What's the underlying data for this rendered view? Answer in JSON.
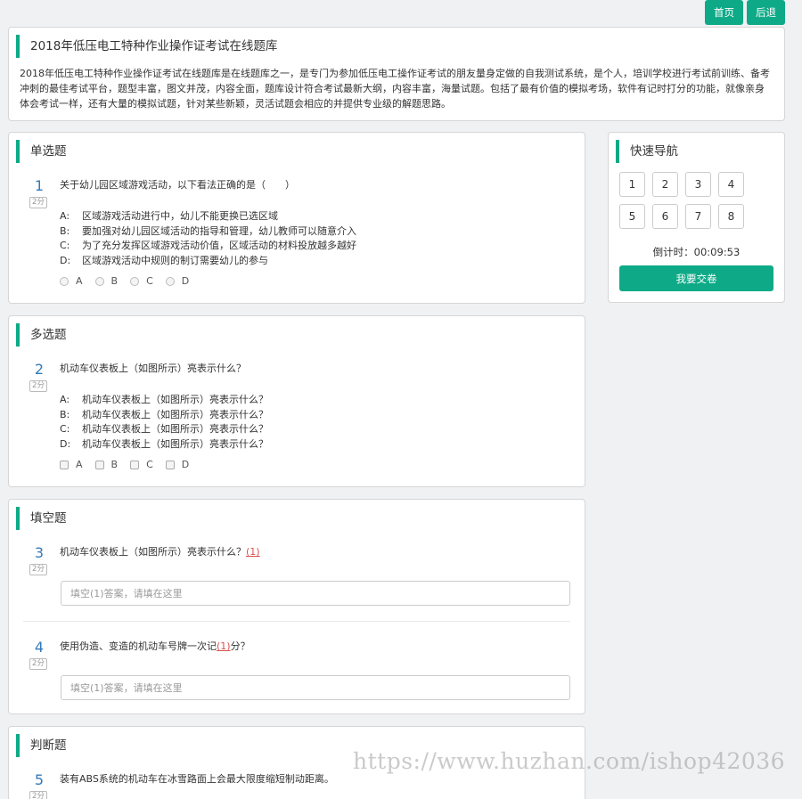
{
  "topbar": {
    "home_label": "首页",
    "back_label": "后退"
  },
  "intro": {
    "title": "2018年低压电工特种作业操作证考试在线题库",
    "description": "2018年低压电工特种作业操作证考试在线题库是在线题库之一，是专门为参加低压电工操作证考试的朋友量身定做的自我测试系统，是个人，培训学校进行考试前训练、备考冲刺的最佳考试平台，题型丰富，图文并茂，内容全面，题库设计符合考试最新大纲，内容丰富，海量试题。包括了最有价值的模拟考场，软件有记时打分的功能，就像亲身体会考试一样，还有大量的模拟试题，针对某些新颖，灵活试题会相应的并提供专业级的解题思路。"
  },
  "single": {
    "title": "单选题",
    "q": {
      "num": "1",
      "score": "2分",
      "text": "关于幼儿园区域游戏活动，以下看法正确的是（　　）",
      "options": [
        {
          "key": "A:",
          "text": "区域游戏活动进行中，幼儿不能更换已选区域"
        },
        {
          "key": "B:",
          "text": "要加强对幼儿园区域活动的指导和管理，幼儿教师可以随意介入"
        },
        {
          "key": "C:",
          "text": "为了充分发挥区域游戏活动价值，区域活动的材料投放越多越好"
        },
        {
          "key": "D:",
          "text": "区域游戏活动中规则的制订需要幼儿的参与"
        }
      ],
      "choices": [
        "A",
        "B",
        "C",
        "D"
      ]
    }
  },
  "multi": {
    "title": "多选题",
    "q": {
      "num": "2",
      "score": "2分",
      "text": "机动车仪表板上（如图所示）亮表示什么？",
      "options": [
        {
          "key": "A:",
          "text": "机动车仪表板上（如图所示）亮表示什么？"
        },
        {
          "key": "B:",
          "text": "机动车仪表板上（如图所示）亮表示什么？"
        },
        {
          "key": "C:",
          "text": "机动车仪表板上（如图所示）亮表示什么？"
        },
        {
          "key": "D:",
          "text": "机动车仪表板上（如图所示）亮表示什么？"
        }
      ],
      "choices": [
        "A",
        "B",
        "C",
        "D"
      ]
    }
  },
  "fill": {
    "title": "填空题",
    "q3": {
      "num": "3",
      "score": "2分",
      "text_before": "机动车仪表板上（如图所示）亮表示什么？",
      "blank": "(1)",
      "text_after": "",
      "placeholder": "填空(1)答案，请填在这里"
    },
    "q4": {
      "num": "4",
      "score": "2分",
      "text_before": "使用伪造、变造的机动车号牌一次记",
      "blank": "(1)",
      "text_after": "分？",
      "placeholder": "填空(1)答案，请填在这里"
    }
  },
  "judge": {
    "title": "判断题",
    "q": {
      "num": "5",
      "score": "2分",
      "text": "装有ABS系统的机动车在冰雪路面上会最大限度缩短制动距离。"
    }
  },
  "nav": {
    "title": "快速导航",
    "buttons": [
      "1",
      "2",
      "3",
      "4",
      "5",
      "6",
      "7",
      "8"
    ],
    "timer": "倒计时：00:09:53",
    "submit_label": "我要交卷"
  },
  "watermark": "https://www.huzhan.com/ishop42036"
}
